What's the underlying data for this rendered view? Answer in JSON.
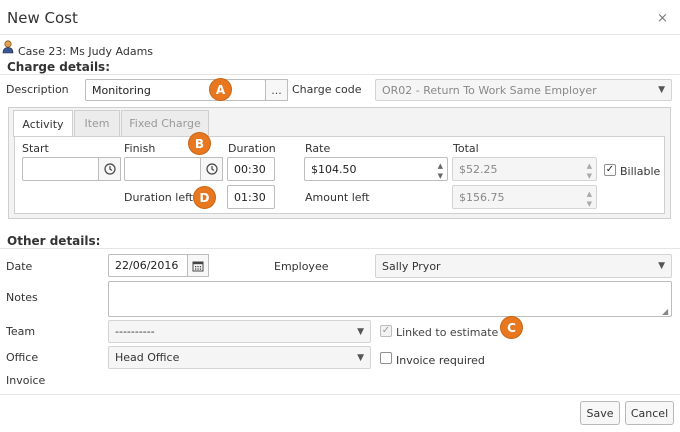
{
  "dialog": {
    "title": "New Cost",
    "close_glyph": "×"
  },
  "case": {
    "label": "Case 23: Ms Judy Adams",
    "icon": "user-icon"
  },
  "charge_details": {
    "heading": "Charge details:",
    "description_label": "Description",
    "description_value": "Monitoring",
    "description_button": "...",
    "charge_code_label": "Charge code",
    "charge_code_value": "OR02 - Return To Work Same Employer"
  },
  "tabs": [
    {
      "label": "Activity",
      "active": true
    },
    {
      "label": "Item",
      "active": false
    },
    {
      "label": "Fixed Charge",
      "active": false
    }
  ],
  "activity": {
    "start_label": "Start",
    "start_value": "",
    "finish_label": "Finish",
    "finish_value": "",
    "duration_label": "Duration",
    "duration_value": "00:30",
    "rate_label": "Rate",
    "rate_value": "$104.50",
    "total_label": "Total",
    "total_value": "$52.25",
    "billable_label": "Billable",
    "billable_checked": true,
    "duration_left_label": "Duration left",
    "duration_left_value": "01:30",
    "amount_left_label": "Amount left",
    "amount_left_value": "$156.75"
  },
  "other_details": {
    "heading": "Other details:",
    "date_label": "Date",
    "date_value": "22/06/2016",
    "employee_label": "Employee",
    "employee_value": "Sally Pryor",
    "notes_label": "Notes",
    "notes_value": "",
    "team_label": "Team",
    "team_value": "----------",
    "linked_label": "Linked to estimate",
    "linked_checked": true,
    "office_label": "Office",
    "office_value": "Head Office",
    "invoice_required_label": "Invoice required",
    "invoice_required_checked": false,
    "invoice_label": "Invoice"
  },
  "badges": {
    "a": "A",
    "b": "B",
    "c": "C",
    "d": "D"
  },
  "footer": {
    "save_label": "Save",
    "cancel_label": "Cancel"
  },
  "colors": {
    "badge": "#e8781f",
    "border": "#bdbdbd"
  }
}
